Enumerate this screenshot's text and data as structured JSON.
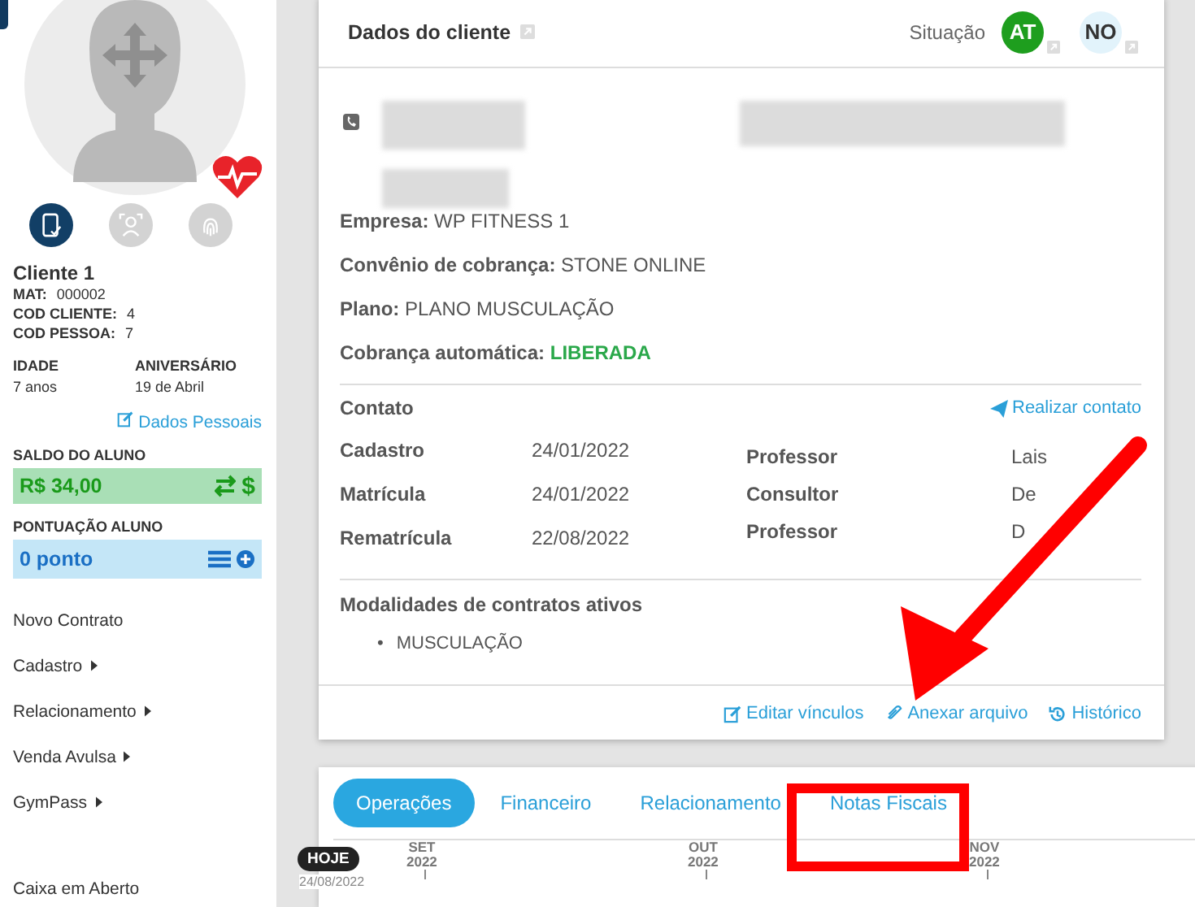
{
  "sidebar": {
    "auth_methods": [
      {
        "kind": "mobile",
        "selected": true
      },
      {
        "kind": "face",
        "selected": false
      },
      {
        "kind": "fingerprint",
        "selected": false
      }
    ],
    "client_name": "Cliente 1",
    "ids": [
      {
        "label": "MAT:",
        "value": "000002"
      },
      {
        "label": "COD CLIENTE:",
        "value": "4"
      },
      {
        "label": "COD PESSOA:",
        "value": "7"
      }
    ],
    "facts": [
      {
        "label": "IDADE",
        "value": "7 anos"
      },
      {
        "label": "ANIVERSÁRIO",
        "value": "19 de Abril"
      }
    ],
    "personal_data_link": "Dados Pessoais",
    "balance": {
      "label": "SALDO DO ALUNO",
      "value": "R$ 34,00",
      "currency_symbol": "$"
    },
    "points": {
      "label": "PONTUAÇÃO ALUNO",
      "value": "0 ponto"
    },
    "menu": [
      {
        "label": "Novo Contrato",
        "submenu": false
      },
      {
        "label": "Cadastro",
        "submenu": true
      },
      {
        "label": "Relacionamento",
        "submenu": true
      },
      {
        "label": "Venda Avulsa",
        "submenu": true
      },
      {
        "label": "GymPass",
        "submenu": true
      },
      {
        "label": "Caixa em Aberto",
        "submenu": false
      }
    ]
  },
  "client_card": {
    "title": "Dados do cliente",
    "status_label": "Situação",
    "status_badges": [
      {
        "text": "AT",
        "color": "#1e9e1e"
      },
      {
        "text": "NO",
        "color": "#e2f3fb"
      }
    ],
    "fields": [
      {
        "label": "Empresa:",
        "value": "WP FITNESS 1",
        "highlight": false
      },
      {
        "label": "Convênio de cobrança:",
        "value": "STONE ONLINE",
        "highlight": false
      },
      {
        "label": "Plano:",
        "value": "PLANO MUSCULAÇÃO",
        "highlight": false
      },
      {
        "label": "Cobrança automática:",
        "value": "LIBERADA",
        "highlight": true
      }
    ],
    "contact": {
      "title": "Contato",
      "action": "Realizar contato",
      "dates": [
        {
          "label": "Cadastro",
          "value": "24/01/2022"
        },
        {
          "label": "Matrícula",
          "value": "24/01/2022"
        },
        {
          "label": "Rematrícula",
          "value": "22/08/2022"
        }
      ],
      "staff": [
        {
          "role": "Professor",
          "name": "Lais"
        },
        {
          "role": "Consultor",
          "name": "De"
        },
        {
          "role": "Professor",
          "name": "D"
        }
      ]
    },
    "modalities": {
      "title": "Modalidades de contratos ativos",
      "items": [
        {
          "bullet": "•",
          "label": "MUSCULAÇÃO"
        }
      ]
    },
    "footer_links": [
      {
        "kind": "edit",
        "label": "Editar vínculos"
      },
      {
        "kind": "attach",
        "label": "Anexar arquivo"
      },
      {
        "kind": "history",
        "label": "Histórico"
      }
    ]
  },
  "tabs": [
    {
      "label": "Operações",
      "selected": true
    },
    {
      "label": "Financeiro",
      "selected": false
    },
    {
      "label": "Relacionamento",
      "selected": false
    },
    {
      "label": "Notas Fiscais",
      "selected": false
    }
  ],
  "timeline": {
    "today_badge": "HOJE",
    "today_date": "24/08/2022",
    "months": [
      {
        "month": "SET",
        "year": "2022"
      },
      {
        "month": "OUT",
        "year": "2022"
      },
      {
        "month": "NOV",
        "year": "2022"
      }
    ]
  },
  "annotations": {
    "arrow": true,
    "highlight_box": true
  }
}
